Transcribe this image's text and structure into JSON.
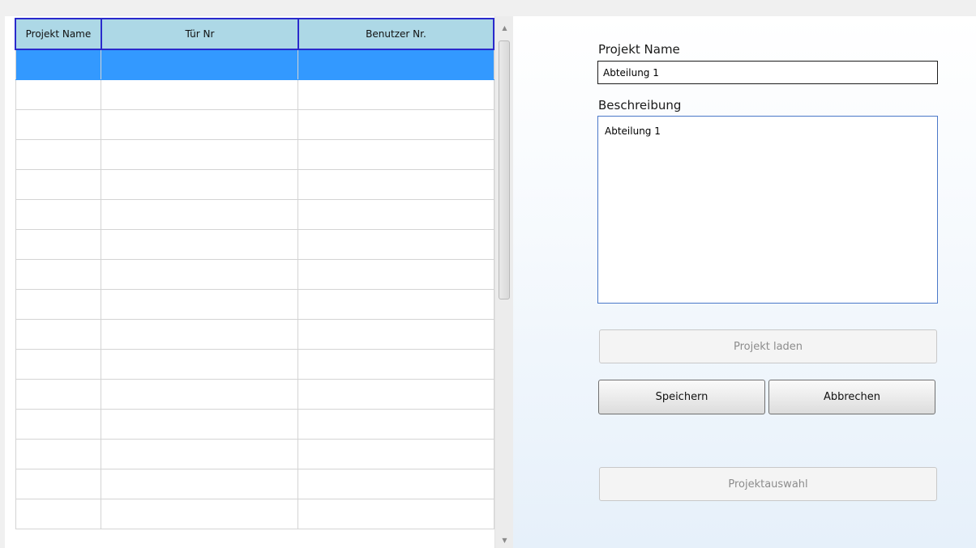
{
  "grid": {
    "columns": [
      "Projekt Name",
      "Tür Nr",
      "Benutzer Nr."
    ],
    "rows": 16,
    "selected_row": 0,
    "selection_color": "#3399ff",
    "header_color": "#add8e6"
  },
  "form": {
    "name_label": "Projekt Name",
    "name_value": "Abteilung 1",
    "description_label": "Beschreibung",
    "description_value": "Abteilung 1"
  },
  "buttons": {
    "load": "Projekt laden",
    "save": "Speichern",
    "cancel": "Abbrechen",
    "select": "Projektauswahl"
  },
  "icons": {
    "scroll_up": "triangle-up-icon",
    "scroll_down": "triangle-down-icon"
  }
}
